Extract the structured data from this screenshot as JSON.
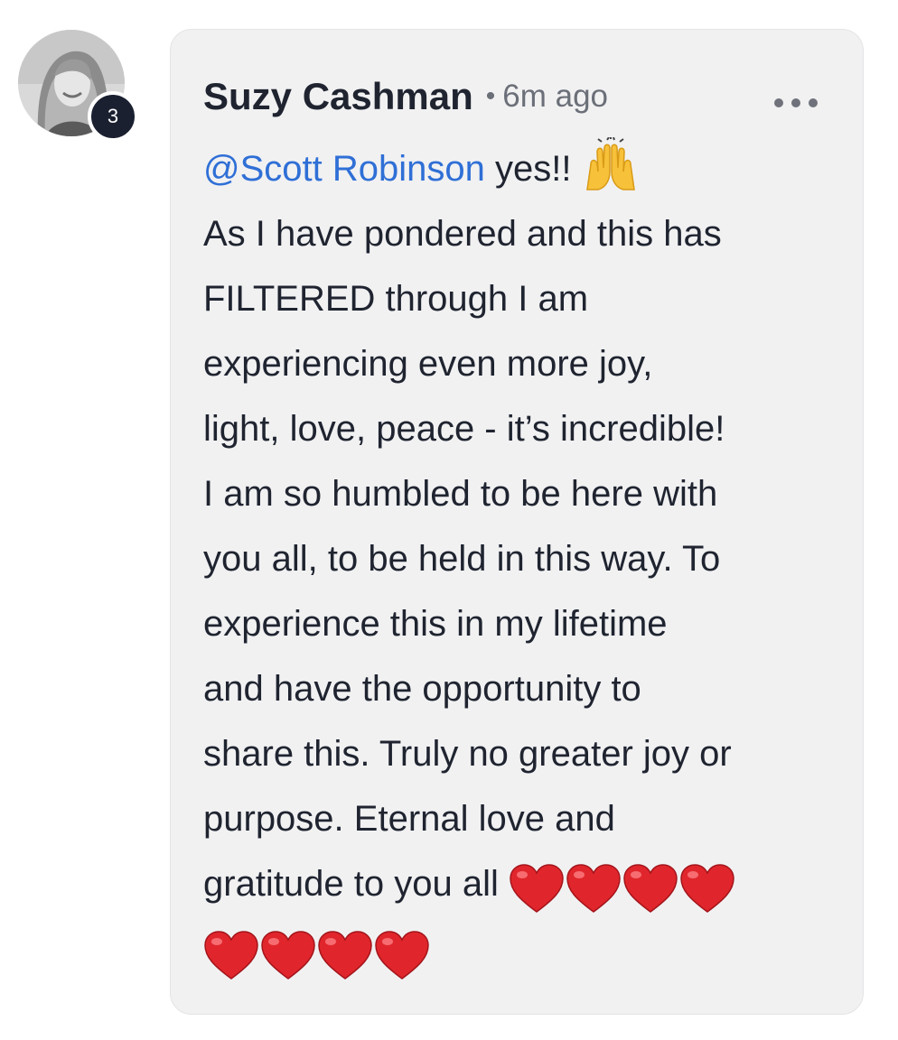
{
  "comment": {
    "avatar_badge": "3",
    "author": "Suzy Cashman",
    "separator": "•",
    "time": "6m ago",
    "more_icon": "more-horizontal-icon",
    "mention": "@Scott Robinson",
    "line1_rest": " yes!!",
    "lines": [
      "As I have pondered and this has",
      "FILTERED through I am",
      "experiencing even more joy,",
      "light, love, peace - it’s incredible!",
      "I am so humbled to be here with",
      "you all, to be held in this way. To",
      "experience this in my lifetime",
      "and have the opportunity to",
      "share this. Truly no greater joy or",
      "purpose. Eternal love and"
    ],
    "last_line_text": "gratitude to you all ",
    "emoji_raising_hands": "🙌",
    "emoji_heart": "❤️",
    "heart_count_line1": 4,
    "heart_count_line2": 4,
    "colors": {
      "bubble_bg": "#f1f1f2",
      "text": "#1f2430",
      "mention": "#2f6fd6",
      "meta": "#6b6f78",
      "badge_bg": "#1a2030",
      "heart": "#e0262c"
    }
  }
}
